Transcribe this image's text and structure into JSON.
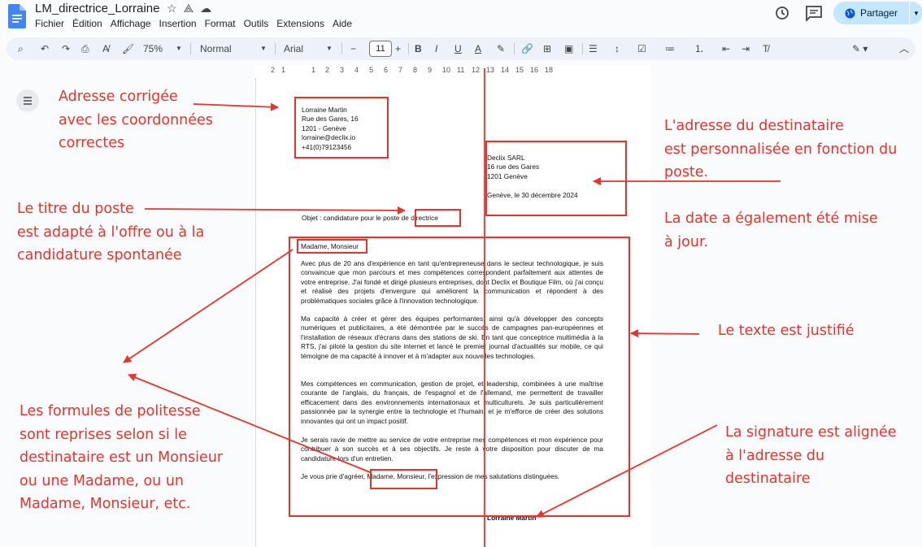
{
  "app": {
    "doc_title": "LM_directrice_Lorraine",
    "share_label": "Partager"
  },
  "menu": [
    "Fichier",
    "Édition",
    "Affichage",
    "Insertion",
    "Format",
    "Outils",
    "Extensions",
    "Aide"
  ],
  "toolbar": {
    "zoom": "75%",
    "style": "Normal",
    "font": "Arial",
    "font_size": "11"
  },
  "ruler": {
    "numbers": [
      "2",
      "1",
      "1",
      "2",
      "3",
      "4",
      "5",
      "6",
      "7",
      "8",
      "9",
      "10",
      "11",
      "12",
      "13",
      "14",
      "15",
      "16",
      "18"
    ]
  },
  "letter": {
    "sender": [
      "Lorraine Martin",
      "Rue des Gares, 16",
      "1201 - Genève",
      "lorraine@declix.io",
      "+41(0)79123456"
    ],
    "recipient": [
      "Declix SARL",
      "16 rue des Gares",
      "1201 Genève"
    ],
    "date": "Genève, le 30 décembre 2024",
    "subject_prefix": "Objet : candidature pour le poste de",
    "subject_role": "directrice",
    "salutation": "Madame, Monsieur",
    "paragraphs": [
      "Avec plus de 20 ans d'expérience en tant qu'entrepreneuse dans le secteur technologique, je suis convaincue que mon parcours et mes compétences correspondent parfaitement aux attentes de votre entreprise. J'ai fondé et dirigé plusieurs entreprises, dont Declix et Boutique Film, où j'ai conçu et réalisé des projets d'envergure qui améliorent la communication et répondent à des problématiques sociales grâce à l'innovation technologique.",
      "Ma capacité à créer et gérer des équipes performantes, ainsi qu'à développer des concepts numériques et publicitaires, a été démontrée par le succès de campagnes pan-européennes et l'installation de réseaux d'écrans dans des stations de ski. En tant que conceptrice multimédia à la RTS, j'ai piloté la gestion du site internet et lancé le premier journal d'actualités sur mobile, ce qui témoigne de ma capacité à innover et à m'adapter aux nouvelles technologies.",
      "Mes compétences en communication, gestion de projet, et leadership, combinées à une maîtrise courante de l'anglais, du français, de l'espagnol et de l'allemand, me permettent de travailler efficacement dans des environnements internationaux et multiculturels. Je suis particulièrement passionnée par la synergie entre la technologie et l'humain, et je m'efforce de créer des solutions innovantes qui ont un impact positif.",
      "Je serais ravie de mettre au service de votre entreprise mes compétences et mon expérience pour contribuer à son succès et à ses objectifs. Je reste à votre disposition pour discuter de ma candidature lors d'un entretien."
    ],
    "closing_prefix": "Je vous prie d'agréer,",
    "closing_salutation": "Madame, Monsieur",
    "closing_suffix": ", l'expression de mes salutations distinguées.",
    "signature": "Lorraine Martin"
  },
  "annotations": {
    "address": [
      "Adresse corrigée",
      "avec les coordonnées",
      "correctes"
    ],
    "recipient": [
      "L'adresse du destinataire",
      "est personnalisée en fonction du",
      "poste."
    ],
    "date": [
      "La date a également été mise",
      "à jour."
    ],
    "title": [
      "Le titre du poste",
      "est adapté à l'offre ou à la",
      "candidature spontanée"
    ],
    "justified": [
      "Le texte est justifié"
    ],
    "politeness": [
      "Les formules de politesse",
      "sont reprises selon si le",
      "destinataire est un Monsieur",
      "ou une Madame, ou un",
      "Madame, Monsieur, etc."
    ],
    "signature": [
      "La signature est alignée",
      "à l'adresse du",
      "destinataire"
    ]
  },
  "colors": {
    "accent": "#e8332a",
    "share": "#c2e7ff",
    "docs_blue": "#4285f4"
  }
}
